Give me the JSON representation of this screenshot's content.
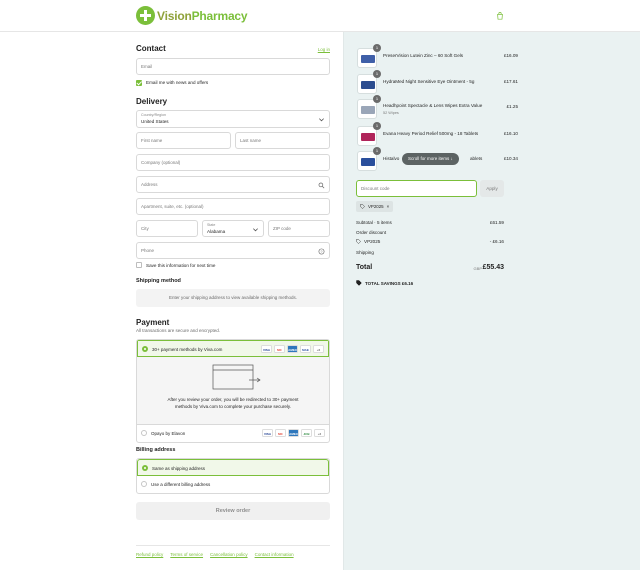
{
  "brand": {
    "vision": "Vision",
    "pharmacy": "Pharmacy"
  },
  "contact": {
    "heading": "Contact",
    "login": "Log in",
    "email_placeholder": "Email",
    "newsletter_label": "Email me with news and offers"
  },
  "delivery": {
    "heading": "Delivery",
    "country_label": "Country/Region",
    "country_value": "United States",
    "first_name": "First name",
    "last_name": "Last name",
    "company": "Company (optional)",
    "address": "Address",
    "apartment": "Apartment, suite, etc. (optional)",
    "city": "City",
    "state_label": "State",
    "state_value": "Alabama",
    "zip": "ZIP code",
    "phone": "Phone",
    "save_label": "Save this information for next time"
  },
  "shipping": {
    "heading": "Shipping method",
    "placeholder": "Enter your shipping address to view available shipping methods."
  },
  "payment": {
    "heading": "Payment",
    "subtitle": "All transactions are secure and encrypted.",
    "option1": "30+ payment methods by Viva.com",
    "redirect_text": "After you review your order, you will be redirected to 30+ payment methods by Viva.com to complete your purchase securely.",
    "option2": "Opayo by Elavon",
    "card_labels": [
      "VISA",
      "MC",
      "AMEX",
      "MAE",
      "+6"
    ],
    "card_labels2": [
      "VISA",
      "MC",
      "AMEX",
      "JCB",
      "+2"
    ]
  },
  "billing": {
    "heading": "Billing address",
    "same": "Same as shipping address",
    "different": "Use a different billing address"
  },
  "review_button": "Review order",
  "footer": [
    "Refund policy",
    "Terms of service",
    "Cancellation policy",
    "Contact information"
  ],
  "cart": {
    "items": [
      {
        "qty": "1",
        "name": "PreserVision Lutein Zinc – 60 Soft Gels",
        "sub": "",
        "price": "£16.09",
        "color": "#3f5fa8"
      },
      {
        "qty": "1",
        "name": "HydraMed Night Sensitive Eye Ointment - 5g",
        "sub": "",
        "price": "£17.61",
        "color": "#2c4d8f"
      },
      {
        "qty": "1",
        "name": "Headhpoint Spectacle & Lens Wipes Extra Value",
        "sub": "52 Wipes",
        "price": "£1.25",
        "color": "#9aa6b8"
      },
      {
        "qty": "1",
        "name": "Evana Heavy Period Relief 500mg - 18 Tablets",
        "sub": "",
        "price": "£16.10",
        "color": "#b0245a"
      },
      {
        "qty": "1",
        "name": "Histalvo",
        "name_tail": "ablets",
        "sub": "",
        "price": "£10.34",
        "color": "#2a4f9c"
      }
    ],
    "scroll_hint": "Scroll for more items",
    "discount_placeholder": "Discount code",
    "apply": "Apply",
    "code": "VP2025",
    "subtotal_label": "Subtotal · 5 items",
    "subtotal_value": "£61.59",
    "order_discount_label": "Order discount",
    "discount_code_label": "VP2025",
    "discount_value": "- £6.16",
    "shipping_label": "Shipping",
    "total_label": "Total",
    "currency": "GBP",
    "total_value": "£55.43",
    "savings": "TOTAL SAVINGS £6.16"
  }
}
